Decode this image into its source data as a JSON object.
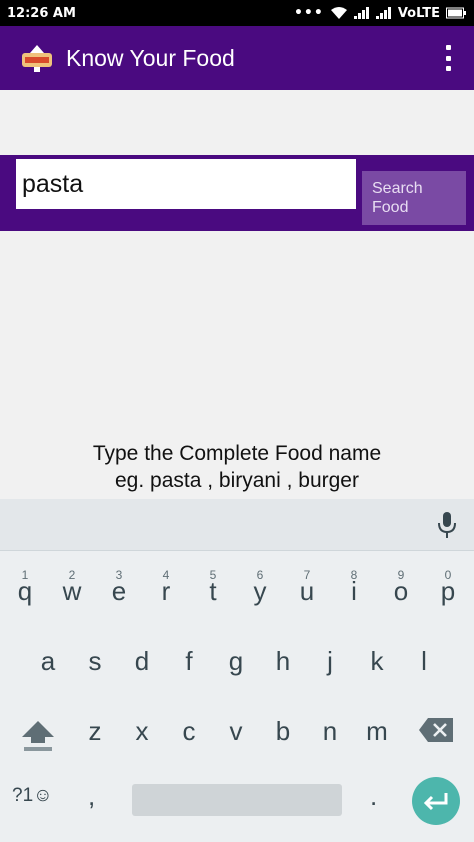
{
  "status_bar": {
    "time": "12:26 AM",
    "dots": "•••",
    "network": "VoLTE"
  },
  "app_bar": {
    "title": "Know Your Food"
  },
  "search": {
    "value": "pasta",
    "button_line1": "Search",
    "button_line2": "Food"
  },
  "hint": {
    "line1": "Type the Complete Food name",
    "line2": "eg. pasta , biryani , burger"
  },
  "keyboard": {
    "row1": [
      {
        "char": "q",
        "num": "1"
      },
      {
        "char": "w",
        "num": "2"
      },
      {
        "char": "e",
        "num": "3"
      },
      {
        "char": "r",
        "num": "4"
      },
      {
        "char": "t",
        "num": "5"
      },
      {
        "char": "y",
        "num": "6"
      },
      {
        "char": "u",
        "num": "7"
      },
      {
        "char": "i",
        "num": "8"
      },
      {
        "char": "o",
        "num": "9"
      },
      {
        "char": "p",
        "num": "0"
      }
    ],
    "row2": [
      "a",
      "s",
      "d",
      "f",
      "g",
      "h",
      "j",
      "k",
      "l"
    ],
    "row3": [
      "z",
      "x",
      "c",
      "v",
      "b",
      "n",
      "m"
    ],
    "symbols_label": "?1☺",
    "comma": ",",
    "period": "."
  },
  "colors": {
    "brand": "#4a0a80",
    "button": "#7a4aa4",
    "enter": "#4db6ac"
  },
  "icons": [
    "app-logo-icon",
    "overflow-menu-icon",
    "wifi-icon",
    "signal-icon",
    "battery-icon",
    "mic-icon",
    "shift-icon",
    "backspace-icon",
    "enter-icon"
  ]
}
